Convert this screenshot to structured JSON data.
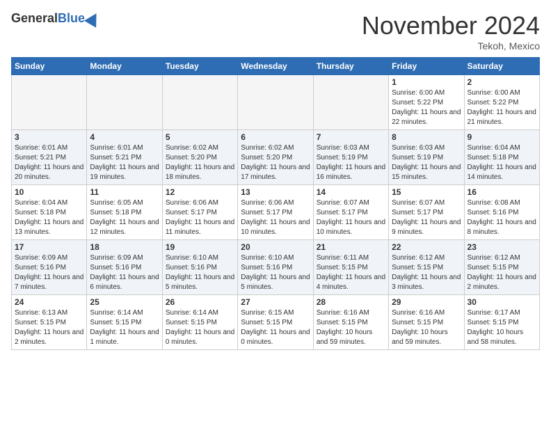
{
  "header": {
    "logo_general": "General",
    "logo_blue": "Blue",
    "month_title": "November 2024",
    "location": "Tekoh, Mexico"
  },
  "days_of_week": [
    "Sunday",
    "Monday",
    "Tuesday",
    "Wednesday",
    "Thursday",
    "Friday",
    "Saturday"
  ],
  "weeks": [
    [
      {
        "day": "",
        "empty": true
      },
      {
        "day": "",
        "empty": true
      },
      {
        "day": "",
        "empty": true
      },
      {
        "day": "",
        "empty": true
      },
      {
        "day": "",
        "empty": true
      },
      {
        "day": "1",
        "sunrise": "Sunrise: 6:00 AM",
        "sunset": "Sunset: 5:22 PM",
        "daylight": "Daylight: 11 hours and 22 minutes."
      },
      {
        "day": "2",
        "sunrise": "Sunrise: 6:00 AM",
        "sunset": "Sunset: 5:22 PM",
        "daylight": "Daylight: 11 hours and 21 minutes."
      }
    ],
    [
      {
        "day": "3",
        "sunrise": "Sunrise: 6:01 AM",
        "sunset": "Sunset: 5:21 PM",
        "daylight": "Daylight: 11 hours and 20 minutes."
      },
      {
        "day": "4",
        "sunrise": "Sunrise: 6:01 AM",
        "sunset": "Sunset: 5:21 PM",
        "daylight": "Daylight: 11 hours and 19 minutes."
      },
      {
        "day": "5",
        "sunrise": "Sunrise: 6:02 AM",
        "sunset": "Sunset: 5:20 PM",
        "daylight": "Daylight: 11 hours and 18 minutes."
      },
      {
        "day": "6",
        "sunrise": "Sunrise: 6:02 AM",
        "sunset": "Sunset: 5:20 PM",
        "daylight": "Daylight: 11 hours and 17 minutes."
      },
      {
        "day": "7",
        "sunrise": "Sunrise: 6:03 AM",
        "sunset": "Sunset: 5:19 PM",
        "daylight": "Daylight: 11 hours and 16 minutes."
      },
      {
        "day": "8",
        "sunrise": "Sunrise: 6:03 AM",
        "sunset": "Sunset: 5:19 PM",
        "daylight": "Daylight: 11 hours and 15 minutes."
      },
      {
        "day": "9",
        "sunrise": "Sunrise: 6:04 AM",
        "sunset": "Sunset: 5:18 PM",
        "daylight": "Daylight: 11 hours and 14 minutes."
      }
    ],
    [
      {
        "day": "10",
        "sunrise": "Sunrise: 6:04 AM",
        "sunset": "Sunset: 5:18 PM",
        "daylight": "Daylight: 11 hours and 13 minutes."
      },
      {
        "day": "11",
        "sunrise": "Sunrise: 6:05 AM",
        "sunset": "Sunset: 5:18 PM",
        "daylight": "Daylight: 11 hours and 12 minutes."
      },
      {
        "day": "12",
        "sunrise": "Sunrise: 6:06 AM",
        "sunset": "Sunset: 5:17 PM",
        "daylight": "Daylight: 11 hours and 11 minutes."
      },
      {
        "day": "13",
        "sunrise": "Sunrise: 6:06 AM",
        "sunset": "Sunset: 5:17 PM",
        "daylight": "Daylight: 11 hours and 10 minutes."
      },
      {
        "day": "14",
        "sunrise": "Sunrise: 6:07 AM",
        "sunset": "Sunset: 5:17 PM",
        "daylight": "Daylight: 11 hours and 10 minutes."
      },
      {
        "day": "15",
        "sunrise": "Sunrise: 6:07 AM",
        "sunset": "Sunset: 5:17 PM",
        "daylight": "Daylight: 11 hours and 9 minutes."
      },
      {
        "day": "16",
        "sunrise": "Sunrise: 6:08 AM",
        "sunset": "Sunset: 5:16 PM",
        "daylight": "Daylight: 11 hours and 8 minutes."
      }
    ],
    [
      {
        "day": "17",
        "sunrise": "Sunrise: 6:09 AM",
        "sunset": "Sunset: 5:16 PM",
        "daylight": "Daylight: 11 hours and 7 minutes."
      },
      {
        "day": "18",
        "sunrise": "Sunrise: 6:09 AM",
        "sunset": "Sunset: 5:16 PM",
        "daylight": "Daylight: 11 hours and 6 minutes."
      },
      {
        "day": "19",
        "sunrise": "Sunrise: 6:10 AM",
        "sunset": "Sunset: 5:16 PM",
        "daylight": "Daylight: 11 hours and 5 minutes."
      },
      {
        "day": "20",
        "sunrise": "Sunrise: 6:10 AM",
        "sunset": "Sunset: 5:16 PM",
        "daylight": "Daylight: 11 hours and 5 minutes."
      },
      {
        "day": "21",
        "sunrise": "Sunrise: 6:11 AM",
        "sunset": "Sunset: 5:15 PM",
        "daylight": "Daylight: 11 hours and 4 minutes."
      },
      {
        "day": "22",
        "sunrise": "Sunrise: 6:12 AM",
        "sunset": "Sunset: 5:15 PM",
        "daylight": "Daylight: 11 hours and 3 minutes."
      },
      {
        "day": "23",
        "sunrise": "Sunrise: 6:12 AM",
        "sunset": "Sunset: 5:15 PM",
        "daylight": "Daylight: 11 hours and 2 minutes."
      }
    ],
    [
      {
        "day": "24",
        "sunrise": "Sunrise: 6:13 AM",
        "sunset": "Sunset: 5:15 PM",
        "daylight": "Daylight: 11 hours and 2 minutes."
      },
      {
        "day": "25",
        "sunrise": "Sunrise: 6:14 AM",
        "sunset": "Sunset: 5:15 PM",
        "daylight": "Daylight: 11 hours and 1 minute."
      },
      {
        "day": "26",
        "sunrise": "Sunrise: 6:14 AM",
        "sunset": "Sunset: 5:15 PM",
        "daylight": "Daylight: 11 hours and 0 minutes."
      },
      {
        "day": "27",
        "sunrise": "Sunrise: 6:15 AM",
        "sunset": "Sunset: 5:15 PM",
        "daylight": "Daylight: 11 hours and 0 minutes."
      },
      {
        "day": "28",
        "sunrise": "Sunrise: 6:16 AM",
        "sunset": "Sunset: 5:15 PM",
        "daylight": "Daylight: 10 hours and 59 minutes."
      },
      {
        "day": "29",
        "sunrise": "Sunrise: 6:16 AM",
        "sunset": "Sunset: 5:15 PM",
        "daylight": "Daylight: 10 hours and 59 minutes."
      },
      {
        "day": "30",
        "sunrise": "Sunrise: 6:17 AM",
        "sunset": "Sunset: 5:15 PM",
        "daylight": "Daylight: 10 hours and 58 minutes."
      }
    ]
  ]
}
